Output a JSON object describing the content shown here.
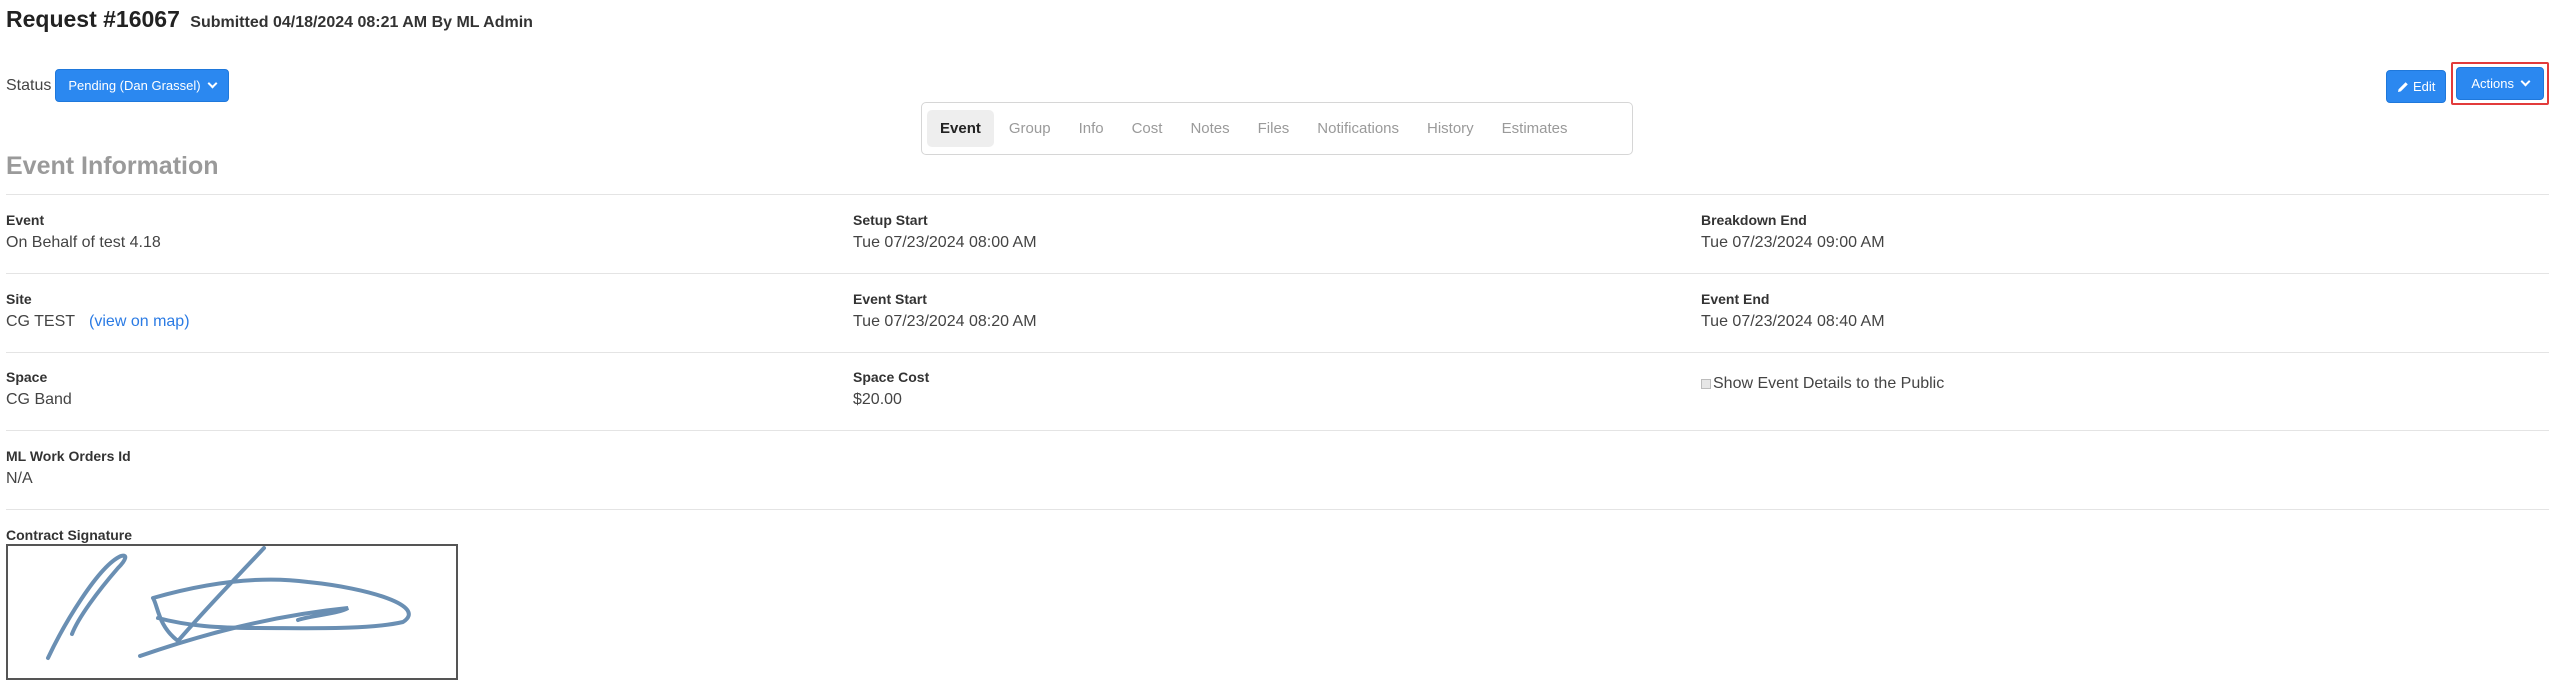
{
  "header": {
    "title": "Request #16067",
    "subtitle": "Submitted 04/18/2024 08:21 AM By ML Admin"
  },
  "status": {
    "label": "Status",
    "value": "Pending (Dan Grassel)"
  },
  "buttons": {
    "edit": "Edit",
    "actions": "Actions"
  },
  "tabs": [
    "Event",
    "Group",
    "Info",
    "Cost",
    "Notes",
    "Files",
    "Notifications",
    "History",
    "Estimates"
  ],
  "section": {
    "title": "Event Information"
  },
  "fields": {
    "event": {
      "label": "Event",
      "value": "On Behalf of test 4.18"
    },
    "setup_start": {
      "label": "Setup Start",
      "value": "Tue 07/23/2024 08:00 AM"
    },
    "breakdown_end": {
      "label": "Breakdown End",
      "value": "Tue 07/23/2024 09:00 AM"
    },
    "site": {
      "label": "Site",
      "value": "CG TEST",
      "link": "(view on map)"
    },
    "event_start": {
      "label": "Event Start",
      "value": "Tue 07/23/2024 08:20 AM"
    },
    "event_end": {
      "label": "Event End",
      "value": "Tue 07/23/2024 08:40 AM"
    },
    "space": {
      "label": "Space",
      "value": "CG Band"
    },
    "space_cost": {
      "label": "Space Cost",
      "value": "$20.00"
    },
    "show_public": {
      "label": "Show Event Details to the Public"
    },
    "work_orders": {
      "label": "ML Work Orders Id",
      "value": "N/A"
    },
    "signature": {
      "label": "Contract Signature"
    }
  },
  "colors": {
    "accent": "#2b88f0",
    "highlight": "#e23b3b",
    "signature_ink": "#6a8fb3"
  }
}
